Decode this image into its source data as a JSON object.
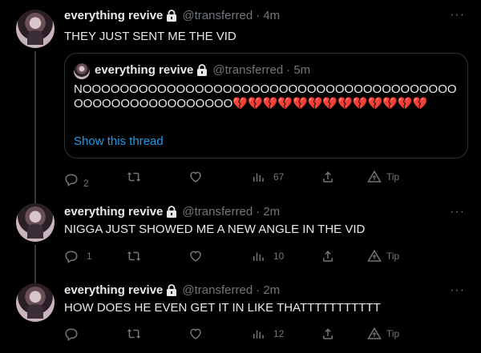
{
  "tweets": [
    {
      "name": "everything revive",
      "handle": "@transferred",
      "time": "· 4m",
      "text": "THEY JUST SENT ME THE VID",
      "quote": {
        "name": "everything revive",
        "handle": "@transferred",
        "time": "· 5m",
        "text": "NOOOOOOOOOOOOOOOOOOOOOOOOOOOOOOOOOOOOOOOOOOOOOOOOOOOOOOOOO💔💔💔💔💔💔💔💔💔💔💔💔💔",
        "link": "Show this thread"
      },
      "replies": "2",
      "retweets": "",
      "likes": "",
      "views": "67",
      "tip": "Tip"
    },
    {
      "name": "everything revive",
      "handle": "@transferred",
      "time": "· 2m",
      "text": "NIGGA JUST SHOWED ME A NEW ANGLE IN THE VID",
      "replies": "1",
      "retweets": "",
      "likes": "",
      "views": "10",
      "tip": "Tip"
    },
    {
      "name": "everything revive",
      "handle": "@transferred",
      "time": "· 2m",
      "text": "HOW DOES HE EVEN GET IT IN LIKE THATTTTTTTTTTT",
      "replies": "",
      "retweets": "",
      "likes": "",
      "views": "12",
      "tip": "Tip"
    }
  ],
  "more_icon": "···",
  "colors": {
    "background": "#000000",
    "text": "#e7e9ea",
    "muted": "#71767b",
    "link": "#1d9bf0",
    "border": "#2f3336"
  }
}
